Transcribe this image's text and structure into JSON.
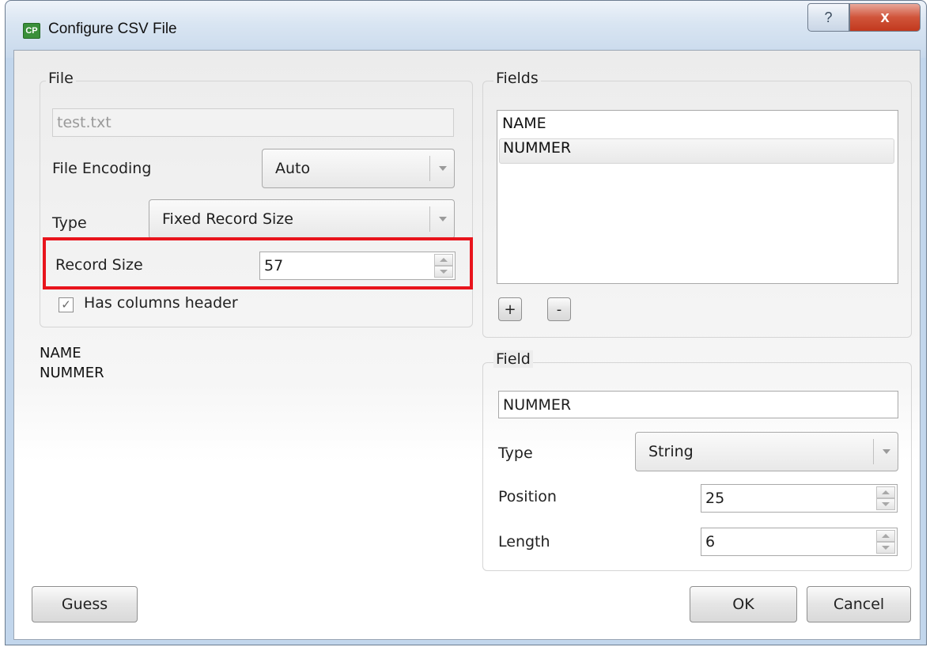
{
  "window": {
    "title": "Configure CSV File",
    "app_icon": "CP",
    "help_label": "?",
    "close_label": "x"
  },
  "file_group": {
    "title": "File",
    "filename": "test.txt",
    "encoding_label": "File Encoding",
    "encoding_value": "Auto",
    "type_label": "Type",
    "type_value": "Fixed Record Size",
    "record_size_label": "Record Size",
    "record_size_value": "57",
    "has_header_label": "Has columns header",
    "has_header_checked": true
  },
  "preview": {
    "lines": [
      "NAME",
      "NUMMER"
    ]
  },
  "fields_group": {
    "title": "Fields",
    "items": [
      "NAME",
      "NUMMER"
    ],
    "selected_index": 1,
    "add_label": "+",
    "remove_label": "-"
  },
  "field_group": {
    "title": "Field",
    "name_value": "NUMMER",
    "type_label": "Type",
    "type_value": "String",
    "position_label": "Position",
    "position_value": "25",
    "length_label": "Length",
    "length_value": "6"
  },
  "buttons": {
    "guess": "Guess",
    "ok": "OK",
    "cancel": "Cancel"
  },
  "colors": {
    "highlight": "#e8141c"
  }
}
